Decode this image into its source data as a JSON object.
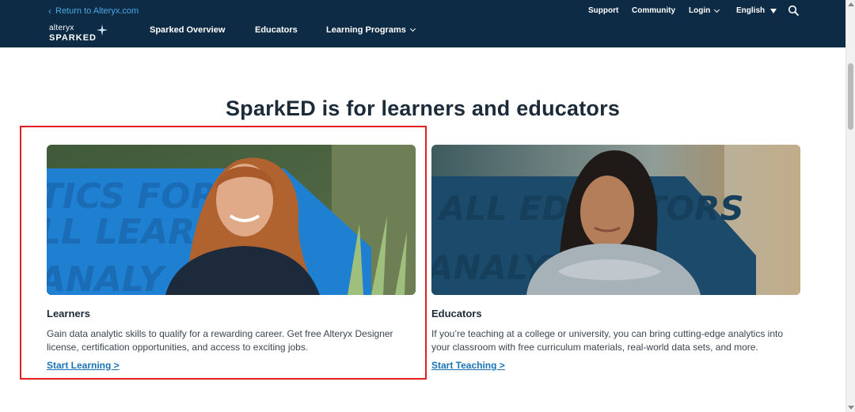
{
  "header": {
    "return_link": "Return to Alteryx.com",
    "logo_top": "alteryx",
    "logo_bottom": "SPARKED",
    "nav": [
      "Sparked Overview",
      "Educators",
      "Learning Programs"
    ],
    "utility": {
      "support": "Support",
      "community": "Community",
      "login": "Login",
      "language": "English"
    },
    "icons": {
      "return": "chevron-left-icon",
      "login": "chevron-down-icon",
      "language": "caret-down-icon",
      "search": "search-icon",
      "logo": "star-icon"
    },
    "colors": {
      "background": "#0e2b45",
      "return_link": "#4aa8e6"
    }
  },
  "main": {
    "headline": "SparkED is for learners and educators",
    "cards": [
      {
        "title": "Learners",
        "description": "Gain data analytic skills to qualify for a rewarding career. Get free Alteryx Designer license, certification opportunities, and access to exciting jobs.",
        "link": "Start Learning >",
        "image_text": "ANALYTICS FOR ALL LEARNERS"
      },
      {
        "title": "Educators",
        "description": "If you’re teaching at a college or university, you can bring cutting-edge analytics into your classroom with free curriculum materials, real-world data sets, and more.",
        "link": "Start Teaching >",
        "image_text": "ALL EDUCATORS ANALYTICS"
      }
    ],
    "colors": {
      "link": "#1a73b8",
      "highlight_border": "#e02020",
      "brand_blue": "#1f7fd0"
    }
  }
}
